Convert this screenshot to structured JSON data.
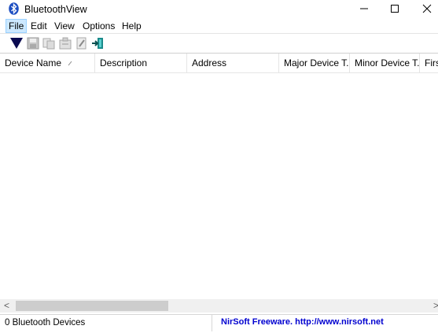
{
  "window": {
    "title": "BluetoothView",
    "icon": "bluetooth-icon"
  },
  "menu": {
    "items": [
      "File",
      "Edit",
      "View",
      "Options",
      "Help"
    ],
    "active": "File"
  },
  "toolbar": {
    "icons": [
      "funnel-icon",
      "save-icon",
      "copy-icon",
      "properties-icon",
      "html-report-icon",
      "exit-icon"
    ]
  },
  "list": {
    "columns": [
      "Device Name",
      "Description",
      "Address",
      "Major Device T...",
      "Minor Device T...",
      "First"
    ],
    "sorted_column": "Device Name",
    "rows": []
  },
  "scrollbar": {
    "left_arrow": "<",
    "right_arrow": ">"
  },
  "status": {
    "count_text": "0 Bluetooth Devices",
    "link_text": "NirSoft Freeware.  http://www.nirsoft.net"
  },
  "colors": {
    "menu_highlight": "#cce8ff",
    "status_link": "#0000d0",
    "bluetooth_blue": "#1e4fc2"
  }
}
